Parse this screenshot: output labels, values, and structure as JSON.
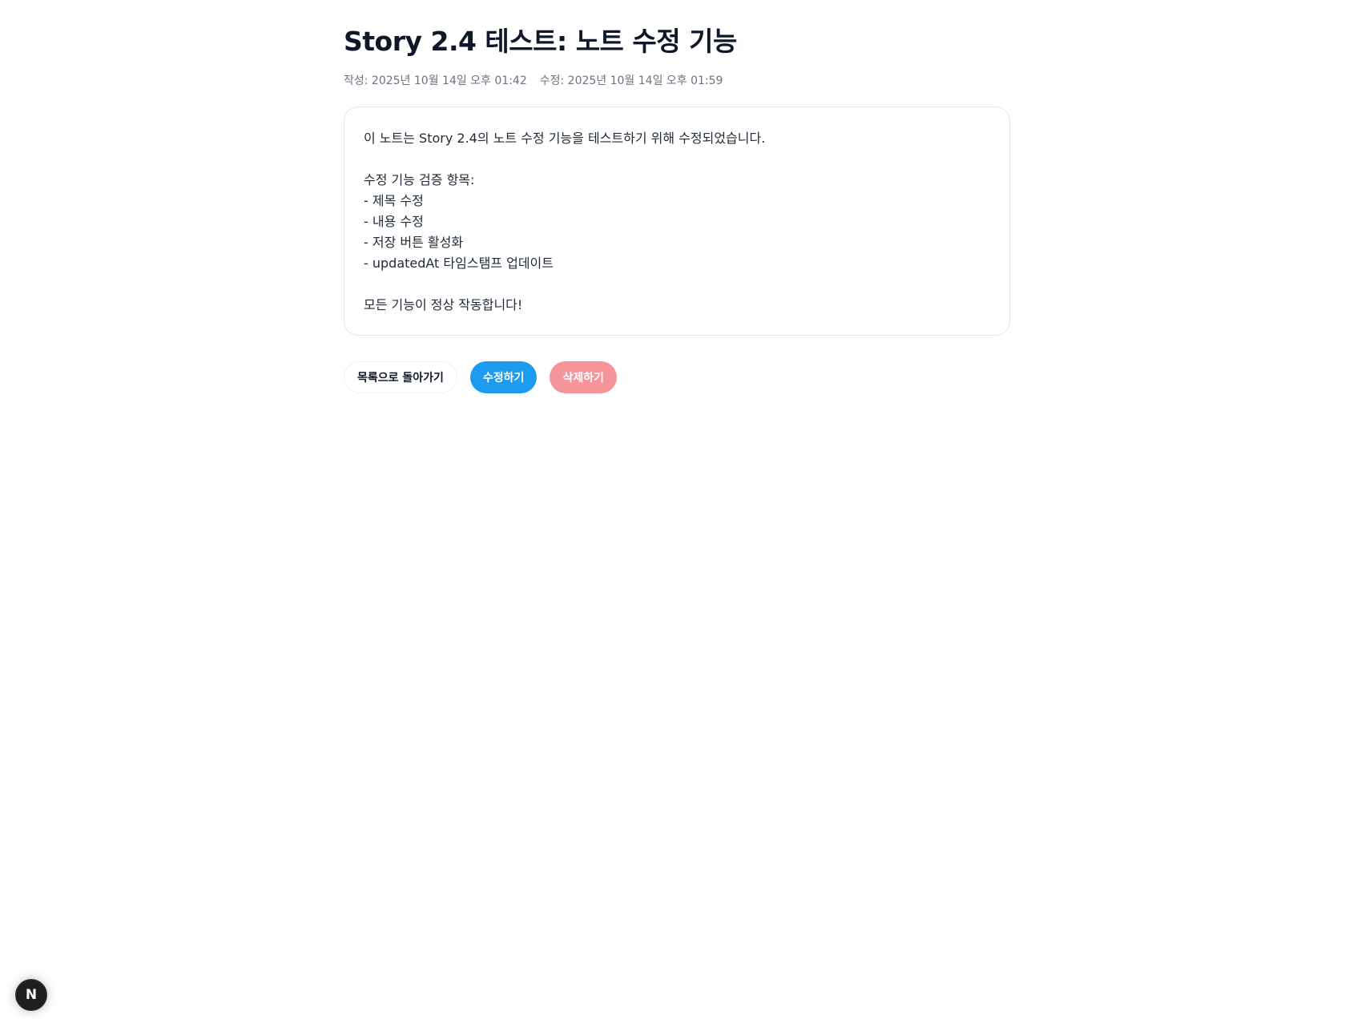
{
  "note": {
    "title": "Story 2.4 테스트: 노트 수정 기능",
    "created_label": "작성: 2025년 10월 14일 오후 01:42",
    "updated_label": "수정: 2025년 10월 14일 오후 01:59",
    "content": "이 노트는 Story 2.4의 노트 수정 기능을 테스트하기 위해 수정되었습니다.\n\n수정 기능 검증 항목:\n- 제목 수정\n- 내용 수정\n- 저장 버튼 활성화\n- updatedAt 타임스탬프 업데이트\n\n모든 기능이 정상 작동합니다!"
  },
  "actions": {
    "back_label": "목록으로 돌아가기",
    "edit_label": "수정하기",
    "delete_label": "삭제하기"
  },
  "dev_badge": {
    "label": "N",
    "icon": "nextjs-dev-indicator-icon"
  },
  "colors": {
    "edit_button": "#1d9bf0",
    "delete_button": "#f5949b",
    "title_text": "#0f172a",
    "meta_text": "#6b7280"
  }
}
